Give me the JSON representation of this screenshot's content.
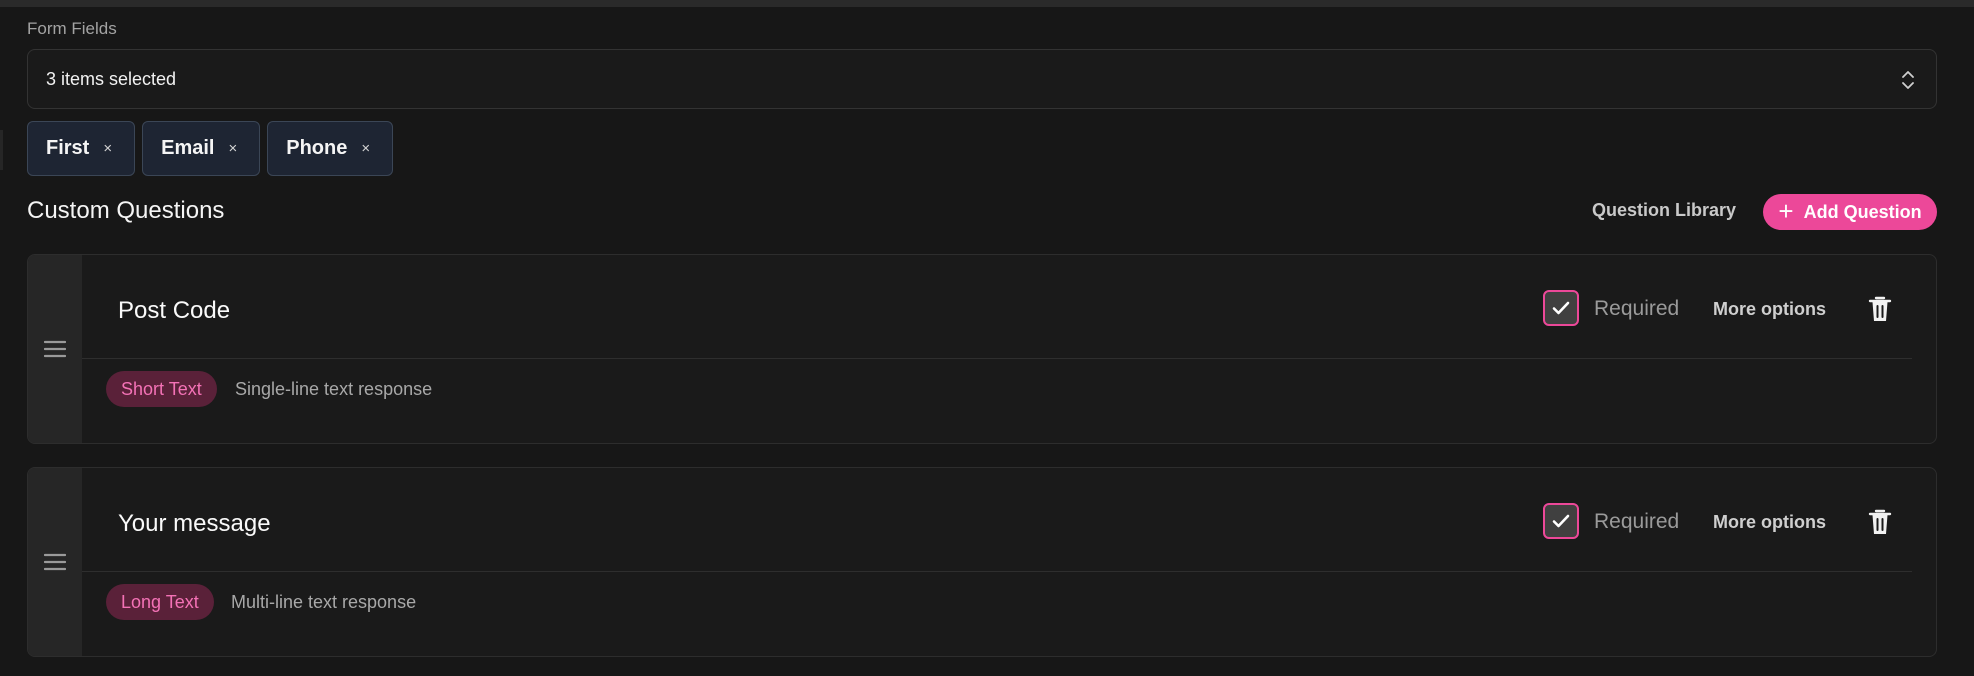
{
  "form_fields": {
    "label": "Form Fields",
    "select_value": "3 items selected",
    "chips": [
      {
        "label": "First",
        "remove": "×"
      },
      {
        "label": "Email",
        "remove": "×"
      },
      {
        "label": "Phone",
        "remove": "×"
      }
    ]
  },
  "custom_questions": {
    "title": "Custom Questions",
    "library_label": "Question Library",
    "add_label": "Add Question",
    "add_icon": "+",
    "questions": [
      {
        "title": "Post Code",
        "required_checked": true,
        "required_label": "Required",
        "more_label": "More options",
        "type_label": "Short Text",
        "type_description": "Single-line text response"
      },
      {
        "title": "Your message",
        "required_checked": true,
        "required_label": "Required",
        "more_label": "More options",
        "type_label": "Long Text",
        "type_description": "Multi-line text response"
      }
    ]
  },
  "colors": {
    "accent": "#ec4899",
    "badge_bg": "#5a2139",
    "background": "#171717"
  },
  "icons": [
    "chevron-up-down-icon",
    "close-icon",
    "plus-icon",
    "drag-handle-icon",
    "checkmark-icon",
    "trash-icon"
  ]
}
